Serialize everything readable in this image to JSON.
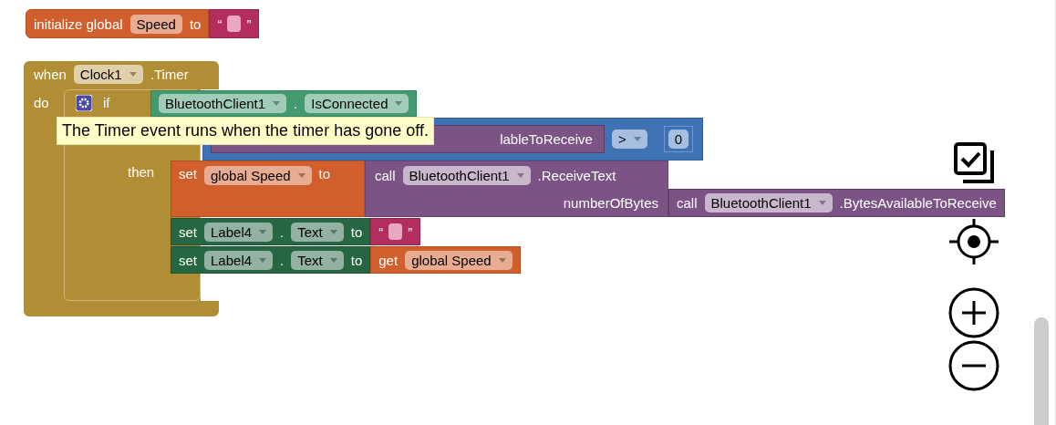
{
  "init_block": {
    "label": "initialize global",
    "name": "Speed",
    "to": "to",
    "value": {
      "kind": "text",
      "open_quote": "“",
      "close_quote": "”"
    }
  },
  "event_block": {
    "when": "when",
    "component": "Clock1",
    "event": ".Timer",
    "do": "do"
  },
  "if_block": {
    "if": "if",
    "condition": {
      "component": "BluetoothClient1",
      "dot": ".",
      "property": "IsConnected"
    }
  },
  "compare_block": {
    "visible_text": "lableToReceive",
    "operator": ">",
    "operand": "0"
  },
  "tooltip": "The Timer event runs when the timer has gone off.",
  "then_label": "then",
  "statements": [
    {
      "kind": "set_variable",
      "set": "set",
      "variable": "global Speed",
      "to": "to",
      "value": {
        "kind": "call",
        "call": "call",
        "component": "BluetoothClient1",
        "method": ".ReceiveText",
        "arg_name": "numberOfBytes",
        "arg": {
          "call": "call",
          "component": "BluetoothClient1",
          "method": ".BytesAvailableToReceive"
        }
      }
    },
    {
      "kind": "set_property",
      "set": "set",
      "component": "Label4",
      "dot": ".",
      "property": "Text",
      "to": "to",
      "value": {
        "kind": "text",
        "open_quote": "“",
        "close_quote": "”"
      }
    },
    {
      "kind": "set_property",
      "set": "set",
      "component": "Label4",
      "dot": ".",
      "property": "Text",
      "to": "to",
      "value": {
        "kind": "get",
        "get": "get",
        "variable": "global Speed"
      }
    }
  ]
}
